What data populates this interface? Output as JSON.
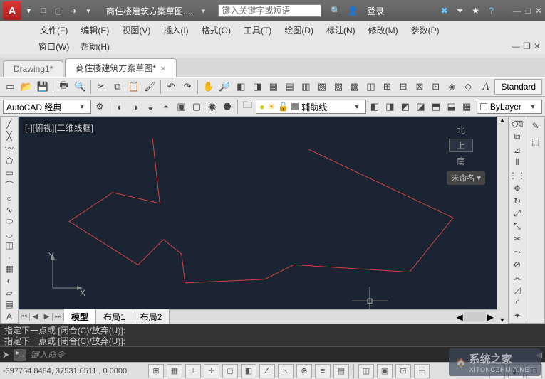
{
  "title": {
    "doc": "商住楼建筑方案草图....",
    "search_placeholder": "键入关键字或短语",
    "login": "登录"
  },
  "menus": [
    "文件(F)",
    "编辑(E)",
    "视图(V)",
    "插入(I)",
    "格式(O)",
    "工具(T)",
    "绘图(D)",
    "标注(N)",
    "修改(M)",
    "参数(P)"
  ],
  "menus2": [
    "窗口(W)",
    "帮助(H)"
  ],
  "tabs": [
    {
      "label": "Drawing1*",
      "active": false
    },
    {
      "label": "商住楼建筑方案草图*",
      "active": true
    }
  ],
  "workspace": {
    "name": "AutoCAD 经典"
  },
  "layer": {
    "status": "辅助线"
  },
  "style": {
    "standard": "Standard",
    "bylayer": "ByLayer"
  },
  "canvas": {
    "label": "[-][俯视][二维线框]",
    "cube_face": "上",
    "unnamed": "未命名 ▾"
  },
  "model_tabs": [
    "模型",
    "布局1",
    "布局2"
  ],
  "cmd": {
    "hist1": "指定下一点或 [闭合(C)/放弃(U)]:",
    "hist2": "指定下一点或 [闭合(C)/放弃(U)]:",
    "prompt": "键入命令"
  },
  "status": {
    "coords": "-397764.8484, 37531.0511 , 0.0000"
  },
  "ucs": {
    "x": "X",
    "y": "Y"
  },
  "watermark": {
    "brand": "系统之家",
    "url": "XITONGZHIJIA.NET"
  }
}
